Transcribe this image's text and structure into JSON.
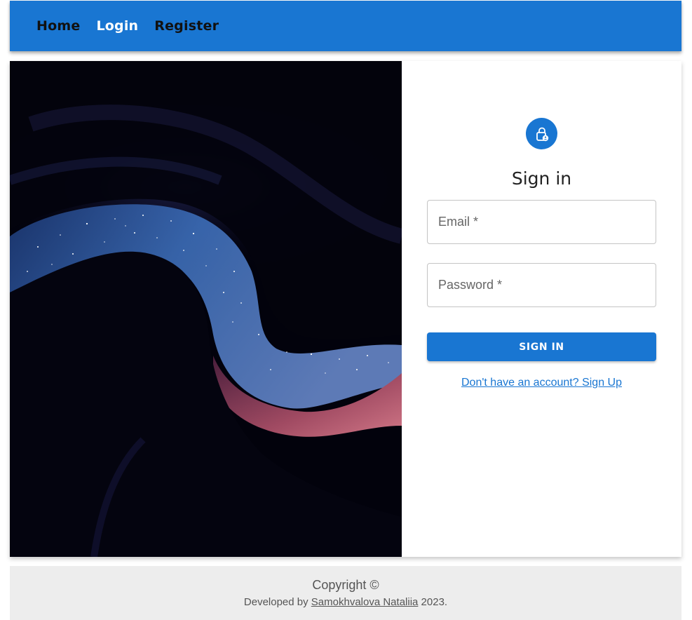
{
  "nav": {
    "links": [
      {
        "label": "Home"
      },
      {
        "label": "Login"
      },
      {
        "label": "Register"
      }
    ]
  },
  "signin": {
    "title": "Sign in",
    "email_placeholder": "Email *",
    "password_placeholder": "Password *",
    "button_label": "SIGN IN",
    "signup_link": "Don't have an account? Sign Up"
  },
  "footer": {
    "copyright": "Copyright ©",
    "developed_prefix": "Developed by ",
    "author": "Samokhvalova Nataliia",
    "year_suffix": " 2023."
  },
  "colors": {
    "primary": "#1976d2",
    "footer_bg": "#ededed"
  },
  "icons": {
    "avatar": "lock-person-icon"
  }
}
